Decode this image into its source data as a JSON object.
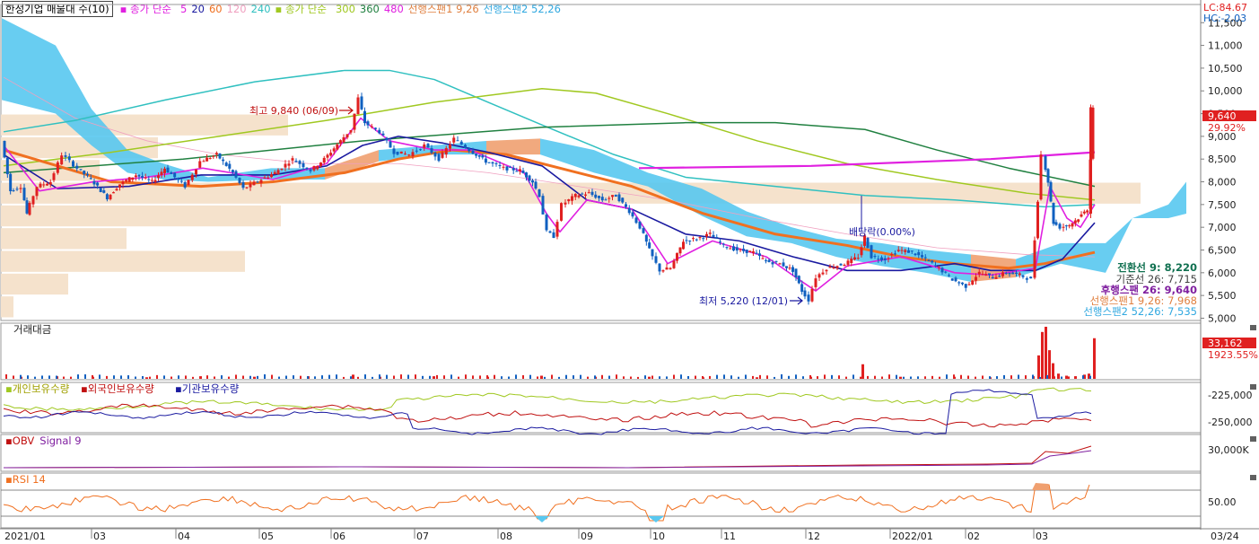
{
  "legend": {
    "stock": "한성기업 매물대 수(10)",
    "ma_label": "종가 단순",
    "ma_values": [
      "5",
      "20",
      "60",
      "120",
      "240"
    ],
    "ma2_label": "종가 단순",
    "ma2_values": [
      "300",
      "360",
      "480"
    ],
    "span1": "선행스팬1 9,26",
    "span2": "선행스팬2 52,26"
  },
  "colors": {
    "ma5": "#e020e0",
    "ma20": "#1a1aa0",
    "ma60": "#f07020",
    "ma120": "#f0a0c0",
    "ma240": "#30c0c0",
    "ma300": "#a0c820",
    "ma360": "#208040",
    "ma480": "#e020e0",
    "up": "#e02020",
    "down": "#1060c0",
    "cloud_blue": "#58c8f0",
    "cloud_orange": "#f0a070",
    "volume_profile": "#f5e2cc"
  },
  "corner": {
    "lc": "LC:84.67",
    "hc": "HC:-2.03"
  },
  "annotations": {
    "high": "최고 9,840 (06/09)",
    "low": "최저 5,220 (12/01)",
    "exdiv": "배당락(0.00%)"
  },
  "ichimoku_labels": [
    {
      "text": "전환선 9: 8,220",
      "color": "#107050"
    },
    {
      "text": "기준선 26: 7,715",
      "color": "#404040"
    },
    {
      "text": "후행스팬 26: 9,640",
      "color": "#8020a0"
    },
    {
      "text": "선행스팬1 9,26: 7,968",
      "color": "#e08040"
    },
    {
      "text": "선행스팬2 52,26: 7,535",
      "color": "#30a8e0"
    }
  ],
  "current": {
    "price": "9,640",
    "change": "29.92%"
  },
  "panels": {
    "volume": {
      "title": "거래대금",
      "value": "33,162",
      "change": "1923.55%"
    },
    "holdings": {
      "title1": "개인보유수량",
      "title2": "외국인보유수량",
      "title3": "기관보유수량",
      "ticks": [
        "-225,000",
        "-250,000"
      ]
    },
    "obv": {
      "title1": "OBV",
      "title2": "Signal 9",
      "ticks": [
        "30,000K"
      ]
    },
    "rsi": {
      "title": "RSI 14",
      "ticks": [
        "50.00"
      ]
    }
  },
  "x_labels": [
    "2021/01",
    "03",
    "04",
    "05",
    "06",
    "07",
    "08",
    "09",
    "10",
    "11",
    "12",
    "2022/01",
    "02",
    "03",
    "03/24"
  ],
  "chart_data": {
    "type": "candlestick",
    "title": "한성기업",
    "y_ticks": [
      5000,
      5500,
      6000,
      6500,
      7000,
      7500,
      8000,
      8500,
      9000,
      9500,
      10000,
      10500,
      11000,
      11500
    ],
    "y_tick_labels": [
      "5,000",
      "5,500",
      "6,000",
      "6,500",
      "7,000",
      "7,500",
      "8,000",
      "8,500",
      "9,000",
      "9,500",
      "10,000",
      "10,500",
      "11,000",
      "11,500"
    ],
    "ylim": [
      4950,
      11900
    ],
    "price_path": [
      [
        0,
        8900
      ],
      [
        10,
        7800
      ],
      [
        22,
        7900
      ],
      [
        28,
        7300
      ],
      [
        40,
        7900
      ],
      [
        55,
        8000
      ],
      [
        68,
        8600
      ],
      [
        85,
        8300
      ],
      [
        100,
        8050
      ],
      [
        118,
        7650
      ],
      [
        132,
        7950
      ],
      [
        150,
        8150
      ],
      [
        168,
        8000
      ],
      [
        182,
        8300
      ],
      [
        205,
        7900
      ],
      [
        222,
        8450
      ],
      [
        240,
        8600
      ],
      [
        258,
        8200
      ],
      [
        270,
        7850
      ],
      [
        290,
        8050
      ],
      [
        305,
        8200
      ],
      [
        325,
        8500
      ],
      [
        345,
        8250
      ],
      [
        360,
        8500
      ],
      [
        378,
        8900
      ],
      [
        390,
        9150
      ],
      [
        398,
        9840
      ],
      [
        405,
        9300
      ],
      [
        422,
        9100
      ],
      [
        438,
        8650
      ],
      [
        455,
        8600
      ],
      [
        472,
        8800
      ],
      [
        488,
        8500
      ],
      [
        505,
        8950
      ],
      [
        522,
        8700
      ],
      [
        540,
        8450
      ],
      [
        560,
        8300
      ],
      [
        578,
        8250
      ],
      [
        592,
        8000
      ],
      [
        600,
        7700
      ],
      [
        608,
        6900
      ],
      [
        616,
        6800
      ],
      [
        625,
        7500
      ],
      [
        640,
        7700
      ],
      [
        655,
        7750
      ],
      [
        670,
        7600
      ],
      [
        685,
        7700
      ],
      [
        700,
        7350
      ],
      [
        712,
        7000
      ],
      [
        722,
        6500
      ],
      [
        734,
        6050
      ],
      [
        746,
        6100
      ],
      [
        760,
        6700
      ],
      [
        775,
        6750
      ],
      [
        790,
        6850
      ],
      [
        805,
        6600
      ],
      [
        820,
        6500
      ],
      [
        838,
        6450
      ],
      [
        852,
        6250
      ],
      [
        868,
        6200
      ],
      [
        882,
        6050
      ],
      [
        892,
        5600
      ],
      [
        900,
        5400
      ],
      [
        908,
        5900
      ],
      [
        920,
        6100
      ],
      [
        940,
        6200
      ],
      [
        955,
        6350
      ],
      [
        962,
        6800
      ],
      [
        970,
        6350
      ],
      [
        985,
        6300
      ],
      [
        1000,
        6500
      ],
      [
        1015,
        6450
      ],
      [
        1030,
        6300
      ],
      [
        1045,
        6100
      ],
      [
        1060,
        5850
      ],
      [
        1075,
        5700
      ],
      [
        1090,
        6000
      ],
      [
        1105,
        5900
      ],
      [
        1120,
        6000
      ],
      [
        1135,
        5950
      ],
      [
        1148,
        5850
      ],
      [
        1155,
        7600
      ],
      [
        1160,
        8600
      ],
      [
        1166,
        8000
      ],
      [
        1172,
        7100
      ],
      [
        1180,
        7000
      ],
      [
        1190,
        7050
      ],
      [
        1200,
        7200
      ],
      [
        1210,
        7400
      ],
      [
        1216,
        9640
      ]
    ],
    "ma5_path": [
      [
        0,
        8800
      ],
      [
        40,
        7800
      ],
      [
        100,
        8000
      ],
      [
        160,
        8100
      ],
      [
        222,
        8300
      ],
      [
        300,
        8050
      ],
      [
        360,
        8400
      ],
      [
        398,
        9400
      ],
      [
        430,
        8900
      ],
      [
        480,
        8700
      ],
      [
        520,
        8700
      ],
      [
        580,
        8200
      ],
      [
        605,
        7300
      ],
      [
        620,
        6900
      ],
      [
        650,
        7600
      ],
      [
        700,
        7400
      ],
      [
        740,
        6200
      ],
      [
        790,
        6700
      ],
      [
        850,
        6350
      ],
      [
        890,
        5800
      ],
      [
        905,
        5600
      ],
      [
        940,
        6150
      ],
      [
        1000,
        6350
      ],
      [
        1060,
        6000
      ],
      [
        1100,
        5950
      ],
      [
        1150,
        6100
      ],
      [
        1166,
        7900
      ],
      [
        1185,
        7200
      ],
      [
        1200,
        7000
      ],
      [
        1216,
        7500
      ]
    ],
    "ma20_path": [
      [
        0,
        8600
      ],
      [
        60,
        7850
      ],
      [
        140,
        7900
      ],
      [
        220,
        8150
      ],
      [
        300,
        8150
      ],
      [
        360,
        8350
      ],
      [
        400,
        8800
      ],
      [
        440,
        9000
      ],
      [
        490,
        8850
      ],
      [
        540,
        8650
      ],
      [
        600,
        8350
      ],
      [
        650,
        7600
      ],
      [
        700,
        7400
      ],
      [
        760,
        6850
      ],
      [
        820,
        6700
      ],
      [
        880,
        6350
      ],
      [
        940,
        6050
      ],
      [
        1000,
        6050
      ],
      [
        1060,
        6200
      ],
      [
        1100,
        6050
      ],
      [
        1150,
        6050
      ],
      [
        1180,
        6300
      ],
      [
        1216,
        7100
      ]
    ],
    "ma60_path": [
      [
        0,
        8700
      ],
      [
        120,
        8000
      ],
      [
        220,
        7900
      ],
      [
        300,
        8000
      ],
      [
        380,
        8200
      ],
      [
        440,
        8500
      ],
      [
        500,
        8700
      ],
      [
        560,
        8600
      ],
      [
        620,
        8300
      ],
      [
        700,
        7900
      ],
      [
        780,
        7300
      ],
      [
        860,
        6850
      ],
      [
        940,
        6600
      ],
      [
        1000,
        6350
      ],
      [
        1060,
        6200
      ],
      [
        1120,
        6100
      ],
      [
        1160,
        6200
      ],
      [
        1216,
        6450
      ]
    ],
    "ma120_path": [
      [
        0,
        10300
      ],
      [
        80,
        9400
      ],
      [
        160,
        8900
      ],
      [
        240,
        8600
      ],
      [
        340,
        8400
      ],
      [
        440,
        8400
      ],
      [
        540,
        8200
      ],
      [
        640,
        7900
      ],
      [
        740,
        7600
      ],
      [
        840,
        7200
      ],
      [
        940,
        6850
      ],
      [
        1040,
        6550
      ],
      [
        1140,
        6400
      ],
      [
        1216,
        6350
      ]
    ],
    "ma240_path": [
      [
        0,
        9100
      ],
      [
        80,
        9350
      ],
      [
        180,
        9800
      ],
      [
        280,
        10200
      ],
      [
        380,
        10450
      ],
      [
        430,
        10450
      ],
      [
        480,
        10250
      ],
      [
        540,
        9750
      ],
      [
        600,
        9250
      ],
      [
        680,
        8600
      ],
      [
        760,
        8100
      ],
      [
        860,
        7900
      ],
      [
        960,
        7700
      ],
      [
        1060,
        7600
      ],
      [
        1160,
        7450
      ],
      [
        1216,
        7500
      ]
    ],
    "ma300_path": [
      [
        0,
        8350
      ],
      [
        120,
        8650
      ],
      [
        240,
        9000
      ],
      [
        360,
        9350
      ],
      [
        480,
        9750
      ],
      [
        600,
        10050
      ],
      [
        660,
        9950
      ],
      [
        740,
        9500
      ],
      [
        840,
        8900
      ],
      [
        940,
        8400
      ],
      [
        1040,
        8050
      ],
      [
        1140,
        7750
      ],
      [
        1216,
        7600
      ]
    ],
    "ma360_path": [
      [
        0,
        8200
      ],
      [
        200,
        8500
      ],
      [
        400,
        8900
      ],
      [
        600,
        9200
      ],
      [
        760,
        9300
      ],
      [
        860,
        9300
      ],
      [
        960,
        9150
      ],
      [
        1040,
        8700
      ],
      [
        1120,
        8300
      ],
      [
        1216,
        7900
      ]
    ],
    "ma480_path": [
      [
        708,
        8300
      ],
      [
        900,
        8350
      ],
      [
        1100,
        8500
      ],
      [
        1216,
        8650
      ]
    ],
    "cloud_segments": [
      [
        0,
        11600,
        9800
      ],
      [
        60,
        11000,
        9500
      ],
      [
        100,
        9600,
        8800
      ],
      [
        140,
        8700,
        8200
      ],
      [
        180,
        8400,
        8050
      ],
      [
        230,
        8100,
        8000
      ],
      [
        300,
        8300,
        8050
      ],
      [
        360,
        8300,
        8050
      ],
      [
        420,
        8700,
        8450
      ],
      [
        480,
        8800,
        8600
      ],
      [
        540,
        8900,
        8600
      ],
      [
        600,
        8950,
        8600
      ],
      [
        660,
        8700,
        8200
      ],
      [
        720,
        8200,
        7900
      ],
      [
        780,
        7850,
        7250
      ],
      [
        830,
        7350,
        6800
      ],
      [
        880,
        7000,
        6650
      ],
      [
        930,
        6750,
        6350
      ],
      [
        980,
        6650,
        6150
      ],
      [
        1030,
        6500,
        6000
      ],
      [
        1080,
        6400,
        5800
      ],
      [
        1130,
        6300,
        5900
      ],
      [
        1180,
        6650,
        6200
      ],
      [
        1230,
        6650,
        6000
      ],
      [
        1260,
        7200,
        7200
      ],
      [
        1300,
        7500,
        7200
      ],
      [
        1320,
        8000,
        7300
      ]
    ],
    "volume_profile": [
      {
        "top": 9500,
        "bottom": 9000,
        "len": 320
      },
      {
        "top": 9000,
        "bottom": 8500,
        "len": 175
      },
      {
        "top": 8500,
        "bottom": 8000,
        "len": 110
      },
      {
        "top": 8000,
        "bottom": 7500,
        "len": 1270
      },
      {
        "top": 7500,
        "bottom": 7000,
        "len": 312
      },
      {
        "top": 7000,
        "bottom": 6500,
        "len": 140
      },
      {
        "top": 6500,
        "bottom": 6000,
        "len": 272
      },
      {
        "top": 6000,
        "bottom": 5500,
        "len": 75
      },
      {
        "top": 5500,
        "bottom": 5000,
        "len": 14
      }
    ],
    "volume_bars": [
      [
        20,
        0.04
      ],
      [
        60,
        0.05
      ],
      [
        100,
        0.04
      ],
      [
        160,
        0.03
      ],
      [
        220,
        0.05
      ],
      [
        280,
        0.04
      ],
      [
        340,
        0.05
      ],
      [
        390,
        0.08
      ],
      [
        420,
        0.04
      ],
      [
        480,
        0.05
      ],
      [
        540,
        0.04
      ],
      [
        600,
        0.06
      ],
      [
        660,
        0.04
      ],
      [
        720,
        0.04
      ],
      [
        780,
        0.03
      ],
      [
        840,
        0.03
      ],
      [
        900,
        0.04
      ],
      [
        958,
        0.28
      ],
      [
        1000,
        0.04
      ],
      [
        1060,
        0.04
      ],
      [
        1100,
        0.03
      ],
      [
        1148,
        0.05
      ],
      [
        1154,
        0.45
      ],
      [
        1158,
        0.9
      ],
      [
        1162,
        1.0
      ],
      [
        1166,
        0.55
      ],
      [
        1170,
        0.3
      ],
      [
        1176,
        0.1
      ],
      [
        1185,
        0.06
      ],
      [
        1195,
        0.05
      ],
      [
        1205,
        0.08
      ],
      [
        1210,
        0.1
      ],
      [
        1216,
        0.78
      ]
    ]
  }
}
